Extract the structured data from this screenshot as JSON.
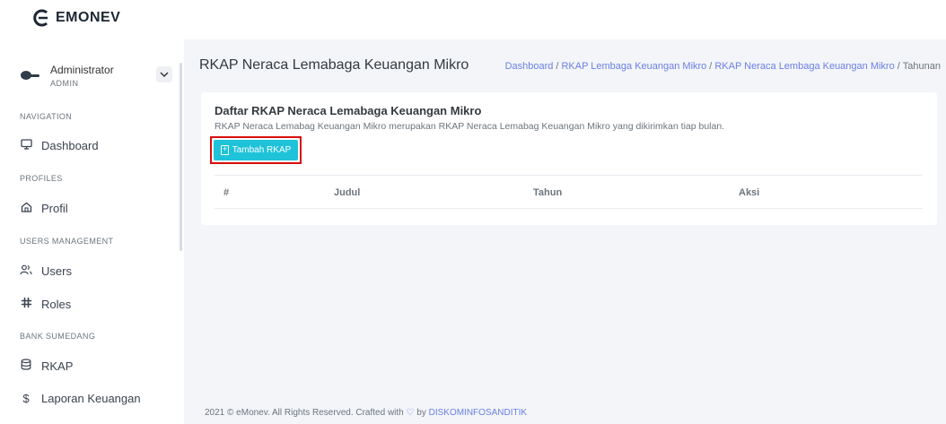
{
  "app": {
    "name": "EMONEV"
  },
  "user": {
    "name": "Administrator",
    "role": "ADMIN"
  },
  "sidebar": {
    "sections": [
      {
        "label": "NAVIGATION",
        "items": [
          {
            "label": "Dashboard",
            "icon": "monitor-icon"
          }
        ]
      },
      {
        "label": "PROFILES",
        "items": [
          {
            "label": "Profil",
            "icon": "home-icon"
          }
        ]
      },
      {
        "label": "USERS MANAGEMENT",
        "items": [
          {
            "label": "Users",
            "icon": "users-icon"
          },
          {
            "label": "Roles",
            "icon": "slack-icon"
          }
        ]
      },
      {
        "label": "BANK SUMEDANG",
        "items": [
          {
            "label": "RKAP",
            "icon": "database-icon"
          },
          {
            "label": "Laporan Keuangan",
            "icon": "dollar-icon"
          }
        ]
      }
    ]
  },
  "page": {
    "title": "RKAP Neraca Lemabaga Keuangan Mikro",
    "breadcrumb": [
      "Dashboard",
      "RKAP Lembaga Keuangan Mikro",
      "RKAP Neraca Lembaga Keuangan Mikro",
      "Tahunan"
    ]
  },
  "card": {
    "title": "Daftar RKAP Neraca Lemabaga Keuangan Mikro",
    "description": "RKAP Neraca Lemabag Keuangan Mikro merupakan RKAP Neraca Lemabag Keuangan Mikro yang dikirimkan tiap bulan.",
    "add_button": "Tambah RKAP",
    "columns": [
      "#",
      "Judul",
      "Tahun",
      "Aksi"
    ]
  },
  "footer": {
    "text": "2021 © eMonev. All Rights Reserved. Crafted with",
    "by": "by",
    "link": "DISKOMINFOSANDITIK"
  },
  "colors": {
    "accent": "#1ec3d9",
    "link": "#6a7fe6",
    "highlight": "#d80d0d"
  }
}
